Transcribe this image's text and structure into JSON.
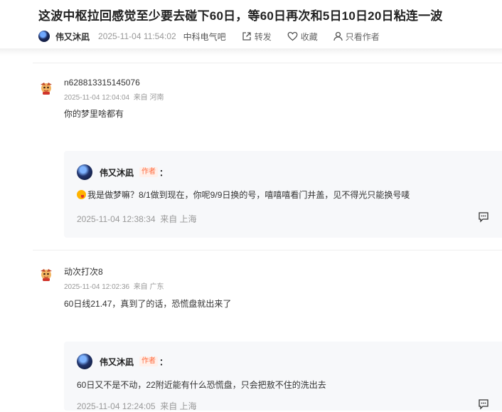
{
  "post": {
    "title": "这波中枢拉回感觉至少要去碰下60日，等60日再次和5日10日20日粘连一波",
    "author": "伟又沐凪",
    "date": "2025-11-04 11:54:02",
    "bar": "中科电气吧",
    "actions": {
      "share": "转发",
      "collect": "收藏",
      "only_author": "只看作者"
    }
  },
  "comments": [
    {
      "user": "n628813315145076",
      "time": "2025-11-04 12:04:04",
      "location": "来自 河南",
      "text": "你的梦里啥都有",
      "reply": {
        "author": "伟又沐凪",
        "badge": "作者",
        "colon": "：",
        "text": "我是做梦嘛？8/1做到现在，你呢9/9日换的号，嘻嘻嘻看门井盖，见不得光只能换号唛",
        "time": "2025-11-04 12:38:34",
        "location": "来自 上海"
      }
    },
    {
      "user": "动次打次8",
      "time": "2025-11-04 12:02:36",
      "location": "来自 广东",
      "text": "60日线21.47，真到了的话，恐慌盘就出来了",
      "reply": {
        "author": "伟又沐凪",
        "badge": "作者",
        "colon": "：",
        "text": "60日又不是不动，22附近能有什么恐慌盘，只会把敖不住的洗出去",
        "time": "2025-11-04 12:24:05",
        "location": "来自 上海"
      }
    }
  ],
  "colors": {
    "badge": "#ff6a3d",
    "reply_bg": "#f7f8fa",
    "muted": "#999999"
  }
}
